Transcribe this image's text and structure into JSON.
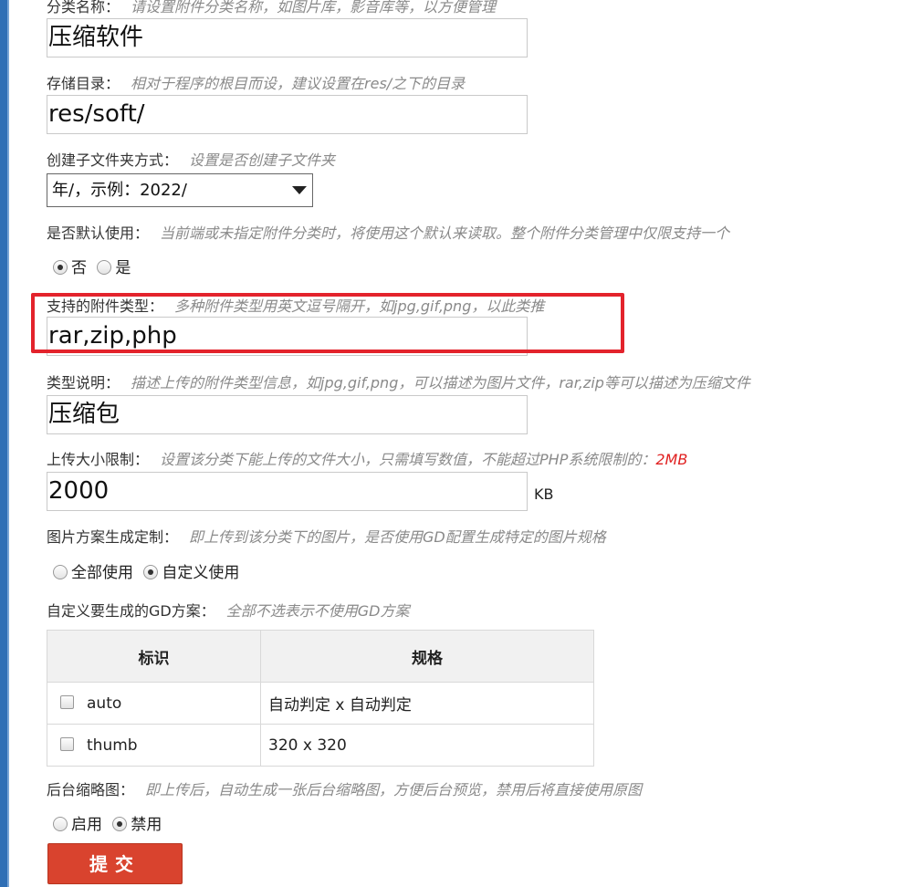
{
  "form": {
    "category_name": {
      "label": "分类名称：",
      "hint": "请设置附件分类名称，如图片库，影音库等，以方便管理",
      "value": "压缩软件"
    },
    "storage_dir": {
      "label": "存储目录：",
      "hint": "相对于程序的根目而设，建议设置在res/之下的目录",
      "value": "res/soft/"
    },
    "subfolder_mode": {
      "label": "创建子文件夹方式：",
      "hint": "设置是否创建子文件夹",
      "selected": "年/，示例：2022/"
    },
    "default_use": {
      "label": "是否默认使用：",
      "hint": "当前端或未指定附件分类时，将使用这个默认来读取。整个附件分类管理中仅限支持一个",
      "options": [
        "否",
        "是"
      ],
      "selected_index": 0
    },
    "file_types": {
      "label": "支持的附件类型：",
      "hint": "多种附件类型用英文逗号隔开，如jpg,gif,png，以此类推",
      "value": "rar,zip,php"
    },
    "type_desc": {
      "label": "类型说明：",
      "hint": "描述上传的附件类型信息，如jpg,gif,png，可以描述为图片文件，rar,zip等可以描述为压缩文件",
      "value": "压缩包"
    },
    "size_limit": {
      "label": "上传大小限制：",
      "hint": "设置该分类下能上传的文件大小，只需填写数值，不能超过PHP系统限制的：",
      "hint_value": "2MB",
      "value": "2000",
      "unit": "KB"
    },
    "image_scheme": {
      "label": "图片方案生成定制：",
      "hint": "即上传到该分类下的图片，是否使用GD配置生成特定的图片规格",
      "options": [
        "全部使用",
        "自定义使用"
      ],
      "selected_index": 1
    },
    "gd_scheme": {
      "label": "自定义要生成的GD方案：",
      "hint": "全部不选表示不使用GD方案",
      "columns": [
        "标识",
        "规格"
      ],
      "rows": [
        {
          "id": "auto",
          "spec": "自动判定 x 自动判定",
          "checked": false
        },
        {
          "id": "thumb",
          "spec": "320 x 320",
          "checked": false
        }
      ]
    },
    "admin_thumb": {
      "label": "后台缩略图：",
      "hint": "即上传后，自动生成一张后台缩略图，方便后台预览，禁用后将直接使用原图",
      "options": [
        "启用",
        "禁用"
      ],
      "selected_index": 1
    },
    "submit_label": "提交"
  },
  "colors": {
    "highlight_border": "#e3232c",
    "submit_bg": "#d9432e",
    "hint_red": "#e02020"
  }
}
